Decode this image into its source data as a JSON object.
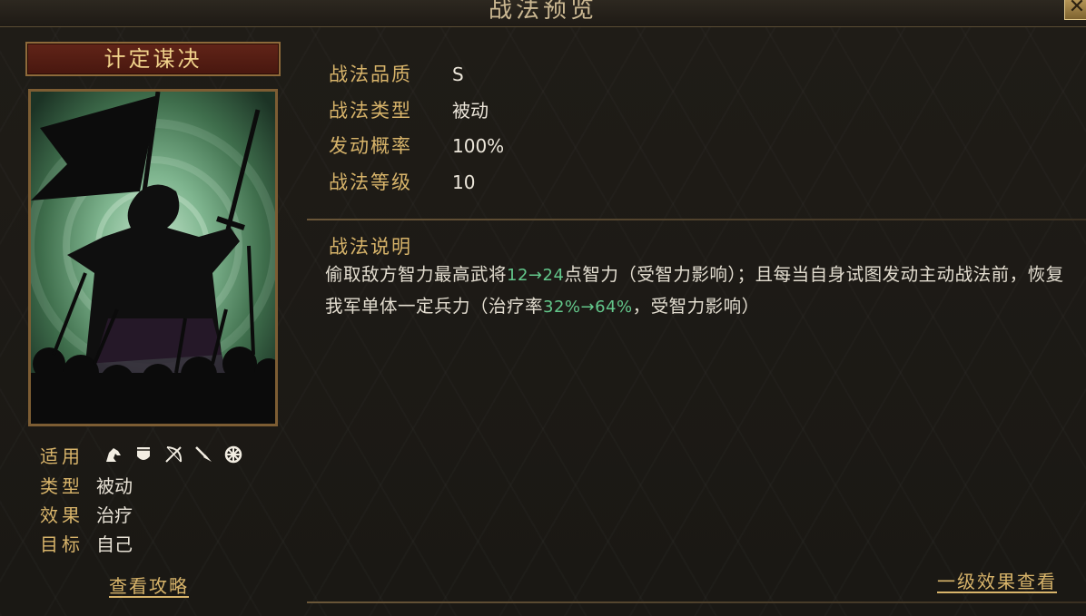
{
  "window": {
    "title": "战法预览",
    "close_glyph": "✕"
  },
  "skill": {
    "name": "计定谋决"
  },
  "attributes": {
    "applicable": {
      "label": "适用",
      "icons": [
        "cavalry-icon",
        "shield-icon",
        "bow-icon",
        "spear-icon",
        "siege-wheel-icon"
      ]
    },
    "type": {
      "label": "类型",
      "value": "被动"
    },
    "effect": {
      "label": "效果",
      "value": "治疗"
    },
    "target": {
      "label": "目标",
      "value": "自己"
    }
  },
  "guide_link": "查看攻略",
  "info": [
    {
      "label": "战法品质",
      "value": "S"
    },
    {
      "label": "战法类型",
      "value": "被动"
    },
    {
      "label": "发动概率",
      "value": "100%"
    },
    {
      "label": "战法等级",
      "value": "10"
    }
  ],
  "description": {
    "title": "战法说明",
    "seg1": "偷取敌方智力最高武将",
    "num1": "12→24",
    "seg2": "点智力（受智力影响）；且每当自身试图发动主动战法前，恢复我军单体一定兵力（治疗率",
    "num2": "32%→64%",
    "seg3": "，受智力影响）"
  },
  "effect_link": "一级效果查看",
  "colors": {
    "gold": "#d8b46a",
    "highlight_green": "#63c78b",
    "title_red": "#612418"
  }
}
